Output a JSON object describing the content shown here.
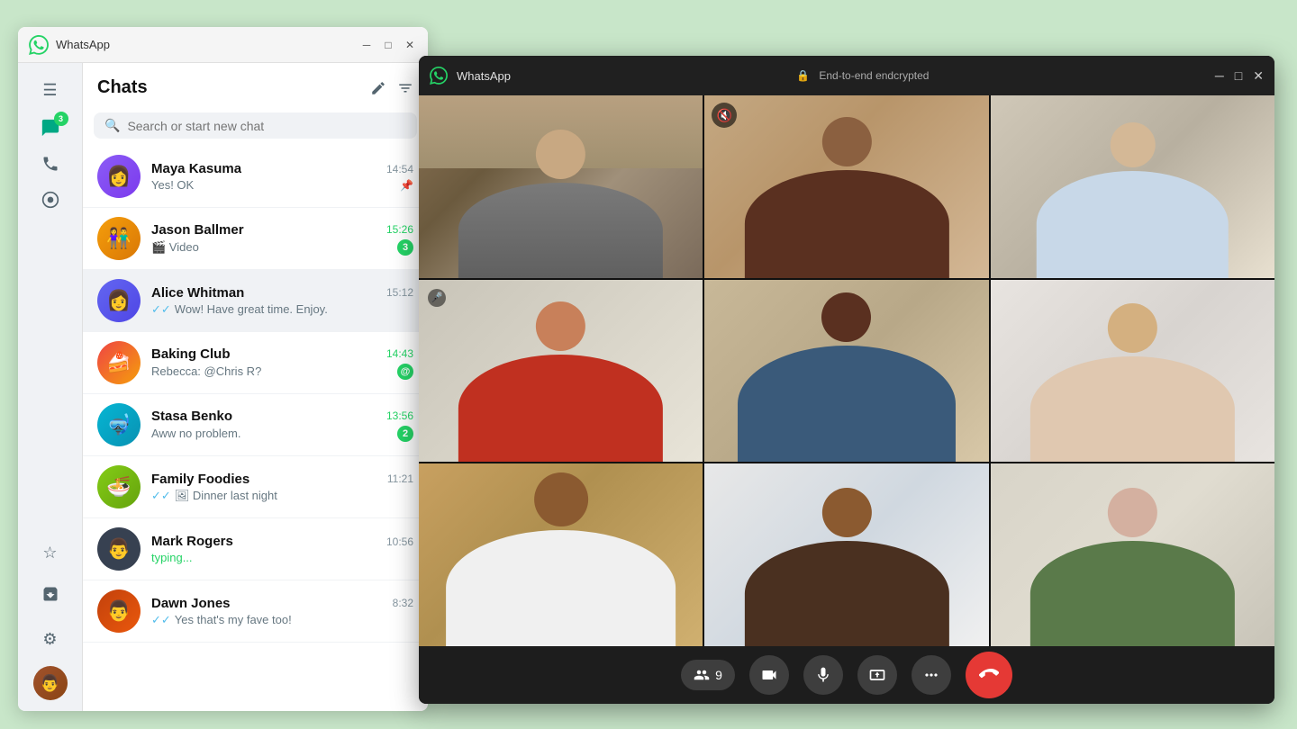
{
  "app": {
    "name": "WhatsApp",
    "titlebar_title": "WhatsApp"
  },
  "sidebar": {
    "badge_count": "3",
    "icons": [
      {
        "name": "menu-icon",
        "symbol": "☰",
        "active": false
      },
      {
        "name": "chats-icon",
        "symbol": "💬",
        "active": true
      },
      {
        "name": "calls-icon",
        "symbol": "📞",
        "active": false
      },
      {
        "name": "status-icon",
        "symbol": "○",
        "active": false
      },
      {
        "name": "starred-icon",
        "symbol": "☆",
        "active": false
      },
      {
        "name": "archived-icon",
        "symbol": "⊡",
        "active": false
      },
      {
        "name": "settings-icon",
        "symbol": "⚙",
        "active": false
      }
    ]
  },
  "chat_panel": {
    "title": "Chats",
    "new_chat_label": "✏",
    "filter_label": "≡",
    "search_placeholder": "Search or start new chat",
    "chats": [
      {
        "id": "maya",
        "name": "Maya Kasuma",
        "time": "14:54",
        "last_message": "Yes! OK",
        "unread": 0,
        "pinned": true,
        "avatar_class": "av-maya",
        "avatar_emoji": "👩"
      },
      {
        "id": "jason",
        "name": "Jason Ballmer",
        "time": "15:26",
        "last_message": "🎬 Video",
        "unread": 3,
        "pinned": false,
        "avatar_class": "av-jason",
        "avatar_emoji": "👫"
      },
      {
        "id": "alice",
        "name": "Alice Whitman",
        "time": "15:12",
        "last_message": "Wow! Have great time. Enjoy.",
        "unread": 0,
        "pinned": false,
        "active": true,
        "avatar_class": "av-alice",
        "avatar_emoji": "👩"
      },
      {
        "id": "baking",
        "name": "Baking Club",
        "time": "14:43",
        "last_message": "Rebecca: @Chris R?",
        "unread": 1,
        "mention": true,
        "pinned": false,
        "avatar_class": "av-baking",
        "avatar_emoji": "🍰"
      },
      {
        "id": "stasa",
        "name": "Stasa Benko",
        "time": "13:56",
        "last_message": "Aww no problem.",
        "unread": 2,
        "pinned": false,
        "avatar_class": "av-stasa",
        "avatar_emoji": "🤿"
      },
      {
        "id": "family",
        "name": "Family Foodies",
        "time": "11:21",
        "last_message": "Dinner last night",
        "unread": 0,
        "pinned": false,
        "avatar_class": "av-family",
        "avatar_emoji": "🍜"
      },
      {
        "id": "mark",
        "name": "Mark Rogers",
        "time": "10:56",
        "last_message": "typing...",
        "typing": true,
        "unread": 0,
        "pinned": false,
        "avatar_class": "av-mark",
        "avatar_emoji": "👤"
      },
      {
        "id": "dawn",
        "name": "Dawn Jones",
        "time": "8:32",
        "last_message": "Yes that's my fave too!",
        "unread": 0,
        "pinned": false,
        "avatar_class": "av-dawn",
        "avatar_emoji": "👨"
      }
    ]
  },
  "video_call": {
    "app_name": "WhatsApp",
    "encryption_label": "End-to-end endcrypted",
    "participants_count": "9",
    "participants": [
      {
        "id": "p1",
        "muted": false,
        "bg": "vid-bg-1"
      },
      {
        "id": "p2",
        "muted": true,
        "bg": "vid-bg-2"
      },
      {
        "id": "p3",
        "muted": false,
        "bg": "vid-bg-3"
      },
      {
        "id": "p4",
        "muted": true,
        "bg": "vid-bg-4"
      },
      {
        "id": "p5",
        "muted": false,
        "bg": "vid-bg-5",
        "highlighted": true
      },
      {
        "id": "p6",
        "muted": false,
        "bg": "vid-bg-6"
      },
      {
        "id": "p7",
        "muted": false,
        "bg": "vid-bg-7"
      },
      {
        "id": "p8",
        "muted": false,
        "bg": "vid-bg-8"
      },
      {
        "id": "p9",
        "muted": false,
        "bg": "vid-bg-9"
      }
    ],
    "controls": {
      "participants_label": "9",
      "camera_label": "📷",
      "mic_label": "🎤",
      "screen_share_label": "📤",
      "more_label": "···",
      "end_call_label": "📞"
    }
  }
}
